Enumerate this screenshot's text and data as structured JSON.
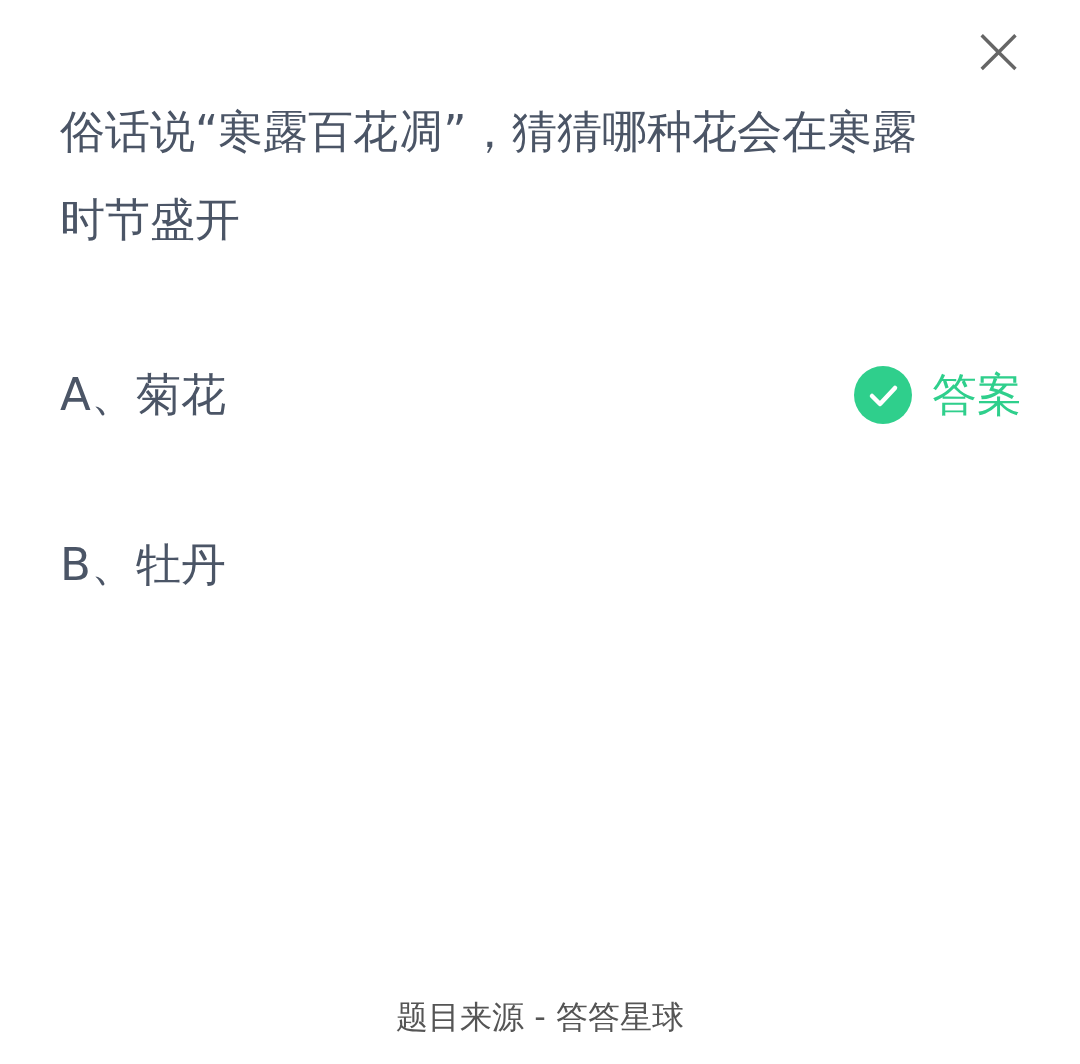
{
  "close": {
    "label": "×"
  },
  "question": "俗话说“寒露百花凋”，猜猜哪种花会在寒露时节盛开",
  "options": [
    {
      "text": "A、菊花",
      "correct": true,
      "badge": "答案"
    },
    {
      "text": "B、牡丹",
      "correct": false
    }
  ],
  "footer": "题目来源 - 答答星球"
}
